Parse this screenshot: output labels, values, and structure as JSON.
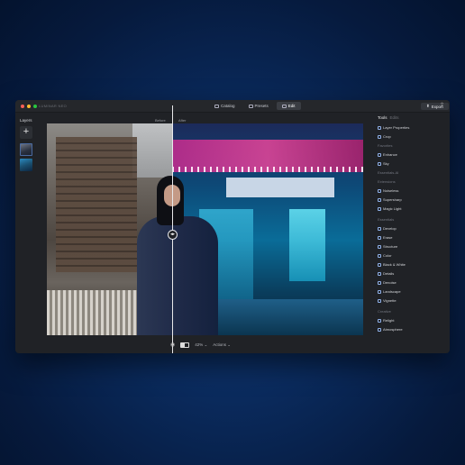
{
  "window": {
    "app_title": "LUMINAR NEO",
    "traffic_lights": [
      "#ff5f57",
      "#febc2e",
      "#28c840"
    ],
    "tabs": [
      {
        "label": "Catalog",
        "active": false
      },
      {
        "label": "Presets",
        "active": false
      },
      {
        "label": "Edit",
        "active": true
      }
    ],
    "export_label": "Export"
  },
  "layers": {
    "title": "Layers",
    "add_label": "+"
  },
  "compare": {
    "before_label": "Before",
    "after_label": "After"
  },
  "bottom_toolbar": {
    "zoom": "42% ⌄",
    "actions": "Actions ⌄"
  },
  "tools_panel": {
    "title": "Tools",
    "subtitle": "Edits",
    "top_items": [
      {
        "label": "Layer Properties",
        "icon": "layer-properties-icon"
      },
      {
        "label": "Crop",
        "icon": "crop-icon"
      }
    ],
    "sections": [
      {
        "title": "Favorites",
        "items": [
          "Enhance",
          "Sky"
        ]
      },
      {
        "title": "Essentials-AI",
        "items": []
      },
      {
        "title": "Extensions",
        "items": [
          "Noiseless",
          "Supersharp",
          "Magic Light"
        ]
      },
      {
        "title": "Essentials",
        "items": [
          "Develop",
          "Erase",
          "Structure",
          "Color",
          "Black & White",
          "Details",
          "Denoise",
          "Landscape",
          "Vignette"
        ]
      },
      {
        "title": "Creative",
        "items": [
          "Relight",
          "Atmosphere"
        ]
      }
    ]
  }
}
